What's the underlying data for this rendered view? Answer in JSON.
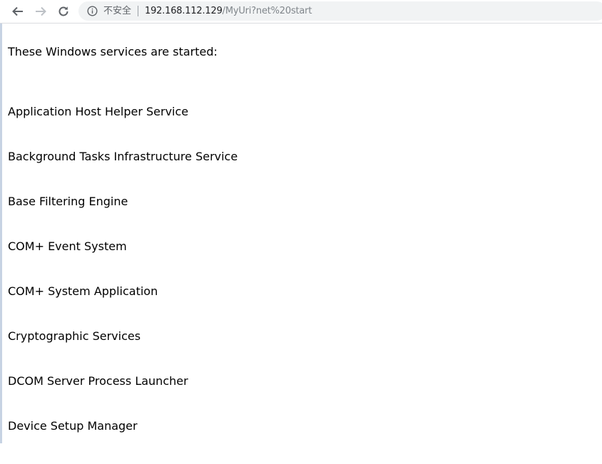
{
  "browser": {
    "back_icon": "arrow-left-icon",
    "forward_icon": "arrow-right-icon",
    "reload_icon": "reload-icon",
    "info_icon": "info-circle-icon",
    "security_label": "不安全",
    "url_host": "192.168.112.129",
    "url_path": "/MyUri?net%20start"
  },
  "page": {
    "intro": "These Windows services are started:",
    "services": [
      "Application Host Helper Service",
      "Background Tasks Infrastructure Service",
      "Base Filtering Engine",
      "COM+ Event System",
      "COM+ System Application",
      "Cryptographic Services",
      "DCOM Server Process Launcher",
      "Device Setup Manager"
    ]
  }
}
